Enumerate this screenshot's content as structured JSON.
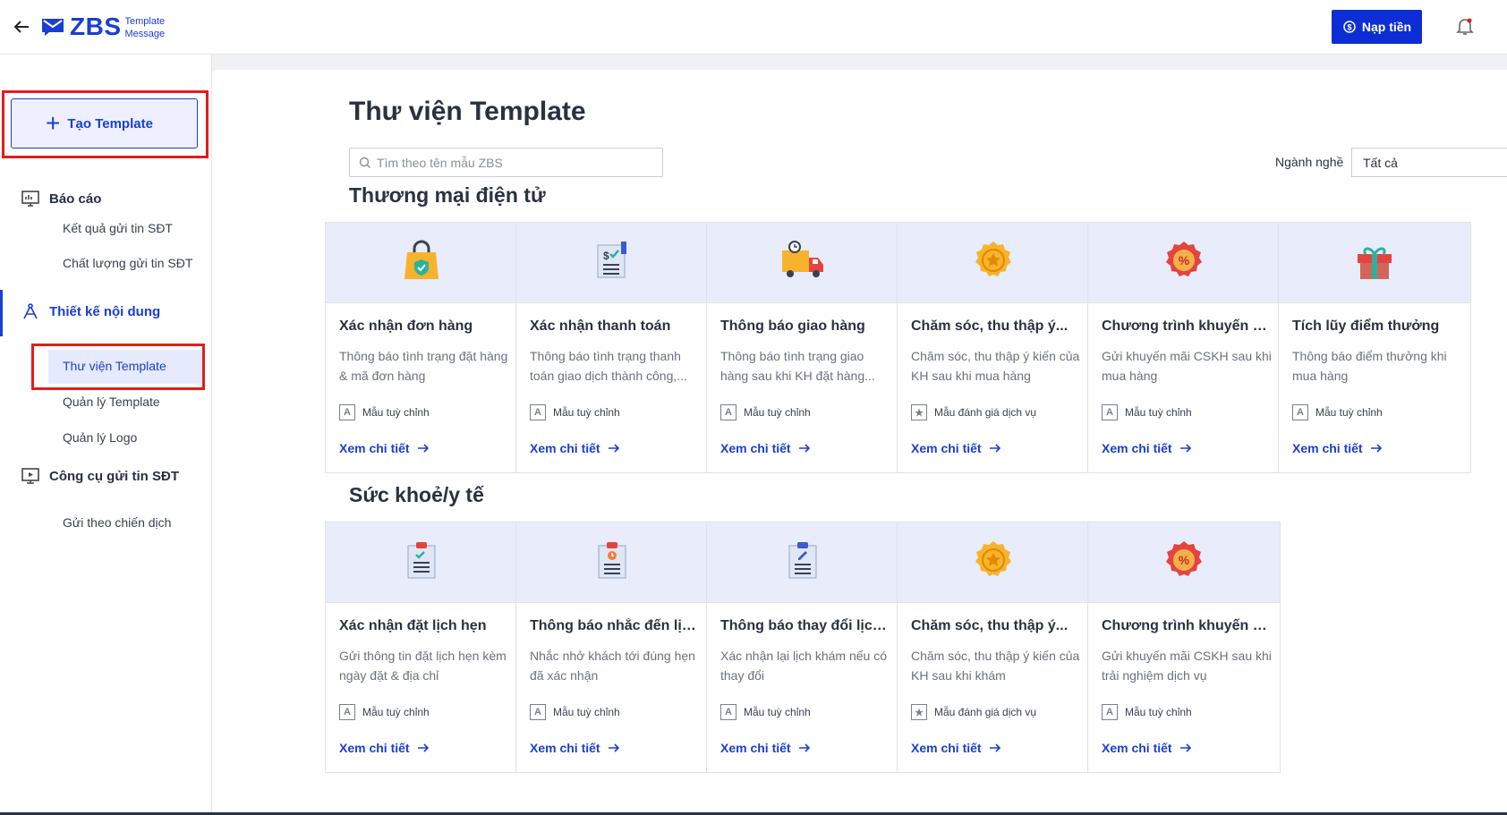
{
  "header": {
    "logo_text": "ZBS",
    "logo_sub_1": "Template",
    "logo_sub_2": "Message",
    "topup_label": "Nạp tiền"
  },
  "sidebar": {
    "create_label": "Tạo Template",
    "groups": [
      {
        "label": "Báo cáo",
        "icon": "report-monitor-icon",
        "items": [
          "Kết quả gửi tin SĐT",
          "Chất lượng gửi tin SĐT"
        ]
      },
      {
        "label": "Thiết kế nội dung",
        "icon": "design-compass-icon",
        "items": [
          "Thư viện Template",
          "Quản lý Template",
          "Quản lý Logo"
        ]
      },
      {
        "label": "Công cụ gửi tin SĐT",
        "icon": "send-tool-icon",
        "items": [
          "Gửi theo chiến dịch"
        ]
      }
    ],
    "active_item": "Thư viện Template"
  },
  "main": {
    "title": "Thư viện Template",
    "search_placeholder": "Tìm theo tên mẫu ZBS",
    "industry_label": "Ngành nghề",
    "industry_value": "Tất cả",
    "sections": [
      {
        "title": "Thương mại điện tử",
        "cards": [
          {
            "icon": "shopping-bag-shield-icon",
            "title": "Xác nhận đơn hàng",
            "desc": "Thông báo tình trạng đặt hàng & mã đơn hàng",
            "tag": "Mẫu tuỳ chỉnh",
            "tag_icon": "A",
            "link": "Xem chi tiết"
          },
          {
            "icon": "invoice-check-icon",
            "title": "Xác nhận thanh toán",
            "desc": "Thông báo tình trạng thanh toán giao dịch thành công,...",
            "tag": "Mẫu tuỳ chỉnh",
            "tag_icon": "A",
            "link": "Xem chi tiết"
          },
          {
            "icon": "delivery-truck-icon",
            "title": "Thông báo giao hàng",
            "desc": "Thông báo tình trạng giao hàng sau khi KH đặt hàng...",
            "tag": "Mẫu tuỳ chỉnh",
            "tag_icon": "A",
            "link": "Xem chi tiết"
          },
          {
            "icon": "star-badge-icon",
            "title": "Chăm sóc, thu thập ý...",
            "desc": "Chăm sóc, thu thập ý kiến của KH sau khi mua hàng",
            "tag": "Mẫu đánh giá dịch vụ",
            "tag_icon": "★",
            "link": "Xem chi tiết"
          },
          {
            "icon": "percent-badge-icon",
            "title": "Chương trình khuyến mãi",
            "desc": "Gửi khuyến mãi CSKH sau khi mua hàng",
            "tag": "Mẫu tuỳ chỉnh",
            "tag_icon": "A",
            "link": "Xem chi tiết"
          },
          {
            "icon": "gift-box-icon",
            "title": "Tích lũy điểm thưởng",
            "desc": "Thông báo điểm thưởng khi mua hàng",
            "tag": "Mẫu tuỳ chỉnh",
            "tag_icon": "A",
            "link": "Xem chi tiết"
          }
        ]
      },
      {
        "title": "Sức khoẻ/y tế",
        "cards": [
          {
            "icon": "clipboard-check-icon",
            "title": "Xác nhận đặt lịch hẹn",
            "desc": "Gửi thông tin đặt lịch hẹn kèm ngày đặt & địa chỉ",
            "tag": "Mẫu tuỳ chỉnh",
            "tag_icon": "A",
            "link": "Xem chi tiết"
          },
          {
            "icon": "clipboard-clock-icon",
            "title": "Thông báo nhắc đến lịc...",
            "desc": "Nhắc nhở khách tới đúng hẹn đã xác nhận",
            "tag": "Mẫu tuỳ chỉnh",
            "tag_icon": "A",
            "link": "Xem chi tiết"
          },
          {
            "icon": "clipboard-edit-icon",
            "title": "Thông báo thay đổi lịch...",
            "desc": "Xác nhận lại lịch khám nếu có thay đổi",
            "tag": "Mẫu tuỳ chỉnh",
            "tag_icon": "A",
            "link": "Xem chi tiết"
          },
          {
            "icon": "star-badge-icon",
            "title": "Chăm sóc, thu thập ý...",
            "desc": "Chăm sóc, thu thập ý kiến của KH sau khi khám",
            "tag": "Mẫu đánh giá dịch vụ",
            "tag_icon": "★",
            "link": "Xem chi tiết"
          },
          {
            "icon": "percent-badge-icon",
            "title": "Chương trình khuyến mãi",
            "desc": "Gửi khuyến mãi CSKH sau khi trải nghiệm dịch vụ",
            "tag": "Mẫu tuỳ chỉnh",
            "tag_icon": "A",
            "link": "Xem chi tiết"
          }
        ]
      }
    ]
  },
  "colors": {
    "brand": "#1a3ed1",
    "highlight": "#e11d1d",
    "card_top": "#e8ecfb"
  }
}
